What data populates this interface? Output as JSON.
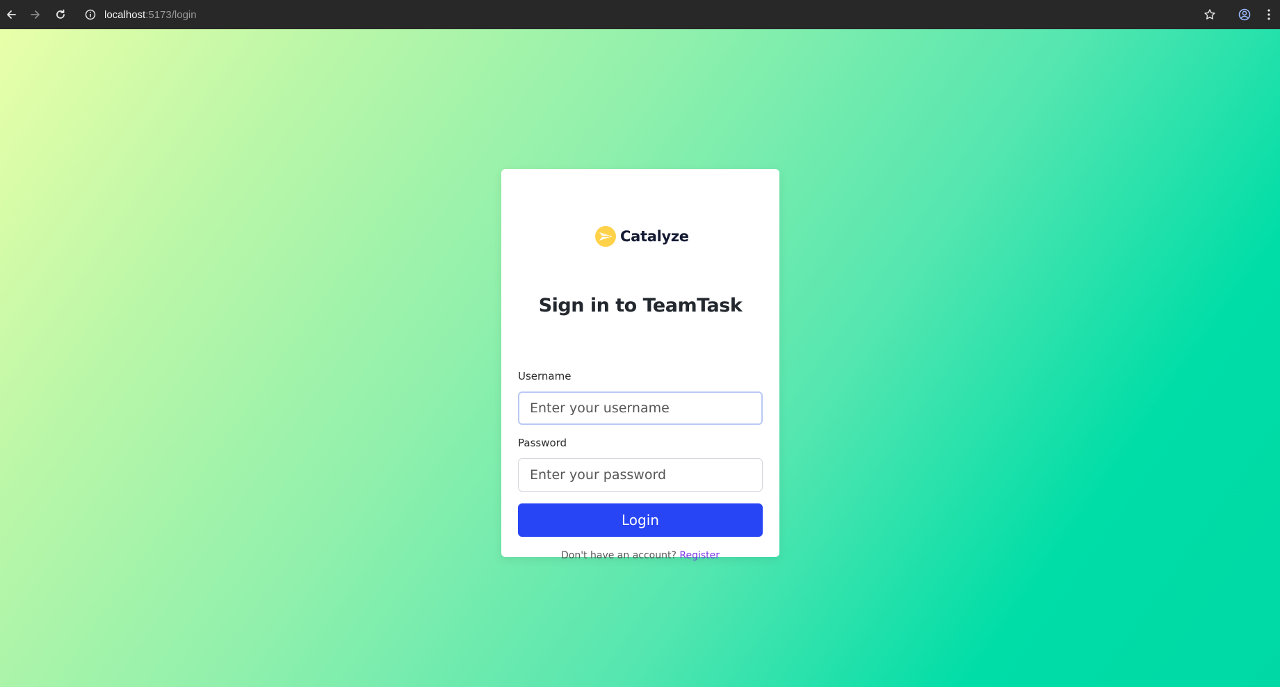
{
  "browser": {
    "url_host": "localhost",
    "url_path": ":5173/login",
    "icons": [
      "back-arrow-icon",
      "forward-arrow-icon",
      "reload-icon",
      "site-info-icon",
      "bookmark-star-icon",
      "profile-icon",
      "menu-dots-icon"
    ]
  },
  "logo": {
    "text": "Catalyze",
    "mark_color": "#ffd24a"
  },
  "form": {
    "title": "Sign in to TeamTask",
    "username_label": "Username",
    "username_placeholder": "Enter your username",
    "password_label": "Password",
    "password_placeholder": "Enter your password",
    "login_label": "Login",
    "register_prompt": "Don't have an account?",
    "register_link": "Register"
  },
  "colors": {
    "button": "#2745f5",
    "link": "#7b35e8",
    "background_start": "#e9ffa9",
    "background_end": "#00d9a6"
  }
}
